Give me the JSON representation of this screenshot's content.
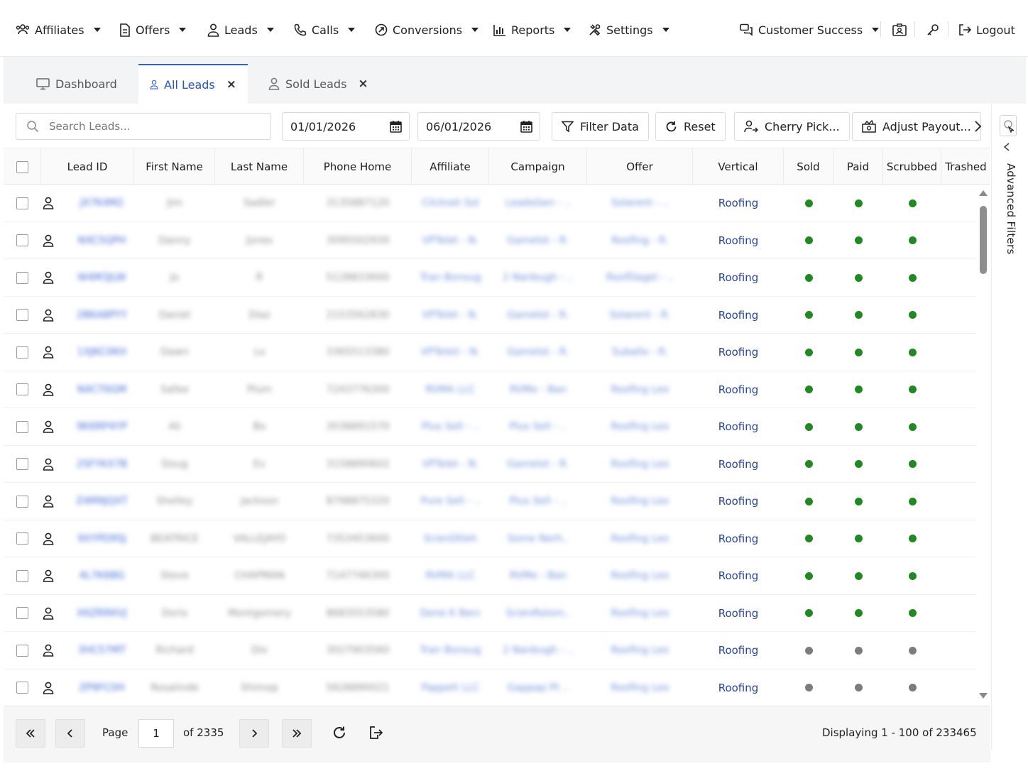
{
  "nav": {
    "affiliates": "Affiliates",
    "offers": "Offers",
    "leads": "Leads",
    "calls": "Calls",
    "conversions": "Conversions",
    "reports": "Reports",
    "settings": "Settings",
    "customer_success": "Customer Success",
    "logout": "Logout",
    "icons": [
      "users-icon",
      "document-icon",
      "user-icon",
      "phone-icon",
      "conversion-icon",
      "bar-chart-icon",
      "tools-icon",
      "chat-icon",
      "id-card-icon",
      "key-icon",
      "logout-icon"
    ]
  },
  "tabs": [
    {
      "label": "Dashboard",
      "closable": false,
      "active": false
    },
    {
      "label": "All Leads",
      "closable": true,
      "active": true
    },
    {
      "label": "Sold Leads",
      "closable": true,
      "active": false
    }
  ],
  "toolbar": {
    "search_placeholder": "Search Leads...",
    "date_from": "01/01/2026",
    "date_to": "06/01/2026",
    "filter_data": "Filter Data",
    "reset": "Reset",
    "cherry_pick": "Cherry Pick...",
    "adjust_payout": "Adjust Payout..."
  },
  "rail": {
    "label": "Advanced Filters"
  },
  "columns": [
    "Lead ID",
    "First Name",
    "Last Name",
    "Phone Home",
    "Affiliate",
    "Campaign",
    "Offer",
    "Vertical",
    "Sold",
    "Paid",
    "Scrubbed",
    "Trashed"
  ],
  "rows": [
    {
      "lead_id": "JX7K4M2",
      "first": "Jim",
      "last": "Sadler",
      "phone": "3135887120",
      "affiliate": "Clickset Sol",
      "campaign": "LeadsGen - ..",
      "offer": "Solarent - ..",
      "vertical": "Roofing",
      "status": "green"
    },
    {
      "lead_id": "NXC5QPH",
      "first": "Danny",
      "last": "Jones",
      "phone": "3095502930",
      "affiliate": "VPTelet - N.",
      "campaign": "Gamelot - R.",
      "offer": "Roofing - R.",
      "vertical": "Roofing",
      "status": "green"
    },
    {
      "lead_id": "W4M3JLW",
      "first": "Jo",
      "last": "R",
      "phone": "5128833600",
      "affiliate": "Tran Bonsug",
      "campaign": "2 Nanbugh - ..",
      "offer": "RoofDagel - ..",
      "vertical": "Roofing",
      "status": "green"
    },
    {
      "lead_id": "2BKA8PYY",
      "first": "Daniel",
      "last": "Diaz",
      "phone": "2153562830",
      "affiliate": "VPTelet - N.",
      "campaign": "Gamelot - R.",
      "offer": "Solarent - R.",
      "vertical": "Roofing",
      "status": "green"
    },
    {
      "lead_id": "1XJKC0KH",
      "first": "Dawn",
      "last": "Lo",
      "phone": "3365513380",
      "affiliate": "VPTeleti - N.",
      "campaign": "Gamelot - R.",
      "offer": "Suballo - R.",
      "vertical": "Roofing",
      "status": "green"
    },
    {
      "lead_id": "N4CT6GM",
      "first": "Safee",
      "last": "Plum",
      "phone": "7243776300",
      "affiliate": "RVMA LLC",
      "campaign": "RVMe - Ban",
      "offer": "Roofing Leo",
      "vertical": "Roofing",
      "status": "green"
    },
    {
      "lead_id": "9K6RP4YP",
      "first": "Ali",
      "last": "Bo",
      "phone": "3038891570",
      "affiliate": "Plus Sell - ..",
      "campaign": "Plus Sell - ..",
      "offer": "Roofing Leo",
      "vertical": "Roofing",
      "status": "green"
    },
    {
      "lead_id": "2SFYKX7B",
      "first": "Doug",
      "last": "Ev",
      "phone": "3158890602",
      "affiliate": "VPTelet - N.",
      "campaign": "Gamelot - R.",
      "offer": "Roofing Leo",
      "vertical": "Roofing",
      "status": "green"
    },
    {
      "lead_id": "Z4M9JQXT",
      "first": "Shelley",
      "last": "Jackson",
      "phone": "8798875320",
      "affiliate": "Pure Sell - ..",
      "campaign": "Plus Sell - ..",
      "offer": "Roofing Leo",
      "vertical": "Roofing",
      "status": "green"
    },
    {
      "lead_id": "9XYPD9SJ",
      "first": "BEATRICE",
      "last": "VALLEJAYO",
      "phone": "7353453600",
      "affiliate": "ScienDtleh",
      "campaign": "Some Nerh..",
      "offer": "Roofing Leo",
      "vertical": "Roofing",
      "status": "green"
    },
    {
      "lead_id": "4L7K6BG",
      "first": "Steve",
      "last": "CHAPMAN",
      "phone": "7147746300",
      "affiliate": "RVMA LLC",
      "campaign": "RVMe - Ban",
      "offer": "Roofing Leo",
      "vertical": "Roofing",
      "status": "green"
    },
    {
      "lead_id": "X6ZRRKVJ",
      "first": "Doris",
      "last": "Montgomery",
      "phone": "8683553580",
      "affiliate": "Dene K Berc",
      "campaign": "ScienRolom..",
      "offer": "Roofing Leo",
      "vertical": "Roofing",
      "status": "green"
    },
    {
      "lead_id": "3HC57MT",
      "first": "Richard",
      "last": "Dix",
      "phone": "3027903560",
      "affiliate": "Tran Bonsug",
      "campaign": "2 Nanbugh - ..",
      "offer": "Roofing Leo",
      "vertical": "Roofing",
      "status": "grey"
    },
    {
      "lead_id": "ZP9FC0H",
      "first": "Rosalinde",
      "last": "Shimop",
      "phone": "5628890021",
      "affiliate": "Pappelt LLC",
      "campaign": "Gappap Pt ..",
      "offer": "Roofing Leo",
      "vertical": "Roofing",
      "status": "grey"
    }
  ],
  "footer": {
    "page_label": "Page",
    "page_value": "1",
    "of_pages": "of 2335",
    "displaying": "Displaying 1 - 100 of 233465"
  },
  "colors": {
    "accent": "#2f63d4",
    "vertical_link": "#27449f",
    "status_green": "#1f8a1f",
    "status_grey": "#7c7c7c"
  }
}
